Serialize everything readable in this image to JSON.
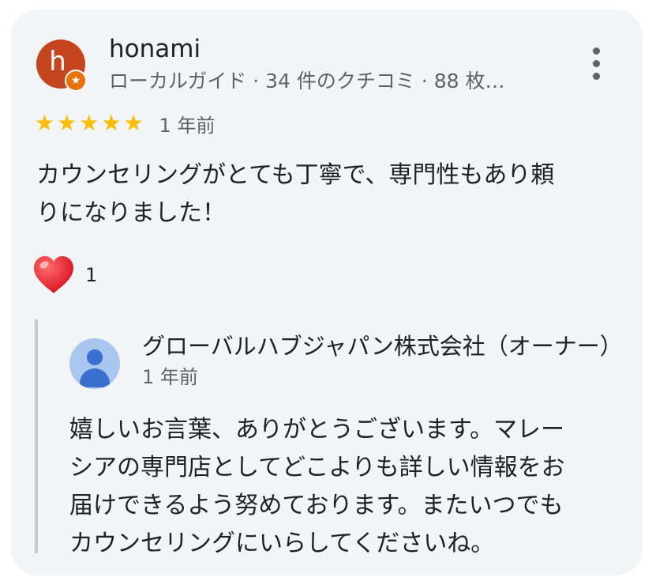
{
  "review": {
    "avatar_letter": "h",
    "avatar_color": "#c4451e",
    "badge_icon": "local-guide-star-icon",
    "reviewer_name": "honami",
    "reviewer_meta": "ローカルガイド · 34 件のクチコミ · 88 枚…",
    "more_icon": "more-vert-icon",
    "rating": 5,
    "rating_max": 5,
    "star_color": "#fbbc04",
    "time": "1 年前",
    "text_line1": "カウンセリングがとても丁寧で、専門性もあり頼",
    "text_line2": "りになりました！",
    "reaction_icon": "heart-icon",
    "reaction_count": "1"
  },
  "reply": {
    "avatar_icon": "person-icon",
    "owner_name": "グローバルハブジャパン株式会社（オーナー）",
    "time": "1 年前",
    "text_line1": "嬉しいお言葉、ありがとうございます。マレー",
    "text_line2": "シアの専門店としてどこよりも詳しい情報をお",
    "text_line3": "届けできるよう努めております。またいつでも",
    "text_line4": "カウンセリングにいらしてくださいね。"
  }
}
